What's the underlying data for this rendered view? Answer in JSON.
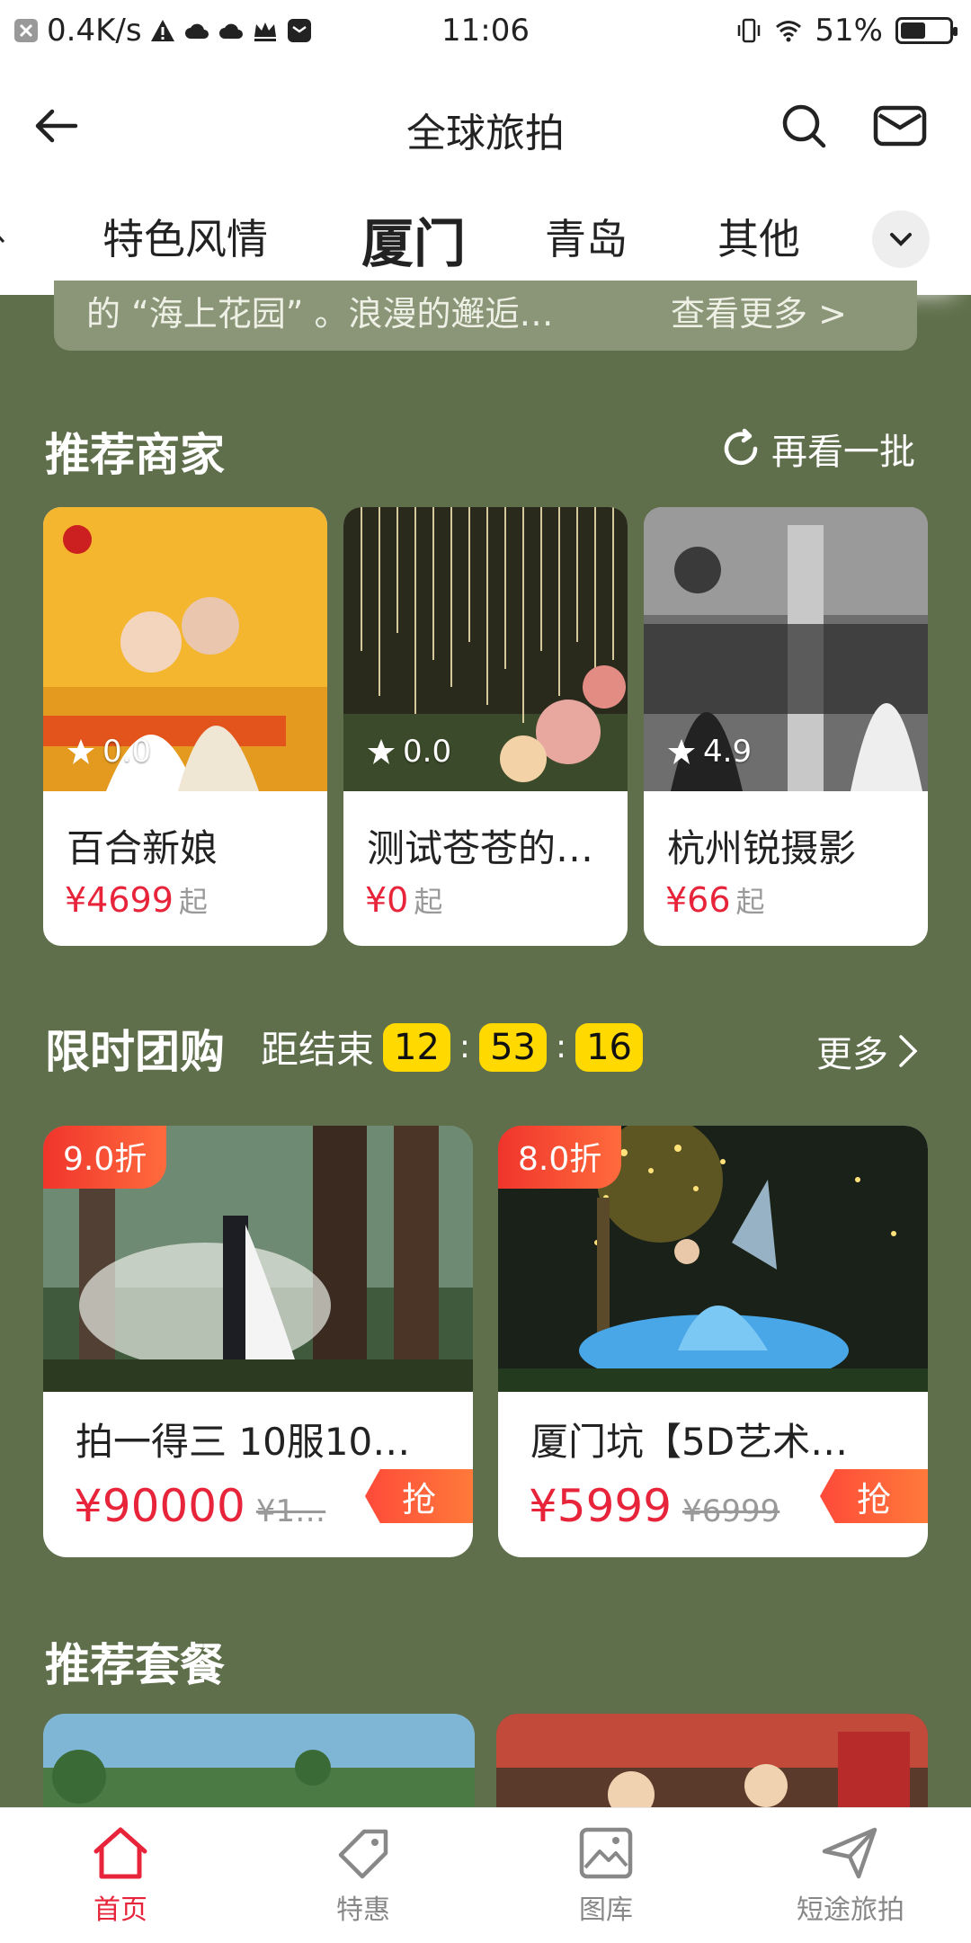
{
  "status_bar": {
    "net_speed": "0.4K/s",
    "time": "11:06",
    "battery": "51%",
    "battery_level": 0.51
  },
  "header": {
    "title": "全球旅拍"
  },
  "tabs": [
    {
      "label": "特色风情",
      "active": false
    },
    {
      "label": "厦门",
      "active": true
    },
    {
      "label": "青岛",
      "active": false
    },
    {
      "label": "其他",
      "active": false
    }
  ],
  "intro": {
    "text": "的 “海上花园” 。浪漫的邂逅…",
    "more": "查看更多 >"
  },
  "merchants": {
    "title": "推荐商家",
    "refresh": "再看一批",
    "items": [
      {
        "name": "百合新娘",
        "rating": "0.0",
        "price": "¥4699",
        "suffix": "起"
      },
      {
        "name": "测试苍苍的…",
        "rating": "0.0",
        "price": "¥0",
        "suffix": "起"
      },
      {
        "name": "杭州锐摄影",
        "rating": "4.9",
        "price": "¥66",
        "suffix": "起"
      }
    ]
  },
  "group_buy": {
    "title": "限时团购",
    "countdown_label": "距结束",
    "hours": "12",
    "minutes": "53",
    "seconds": "16",
    "more": "更多",
    "items": [
      {
        "badge": "9.0折",
        "name": "拍一得三 10服10…",
        "price": "¥90000",
        "orig": "¥1…",
        "grab": "抢"
      },
      {
        "badge": "8.0折",
        "name": "厦门坑【5D艺术…",
        "price": "¥5999",
        "orig": "¥6999",
        "grab": "抢"
      }
    ]
  },
  "packages": {
    "title": "推荐套餐"
  },
  "bottom_nav": [
    {
      "label": "首页",
      "icon": "home-icon",
      "active": true
    },
    {
      "label": "特惠",
      "icon": "tag-icon",
      "active": false
    },
    {
      "label": "图库",
      "icon": "gallery-icon",
      "active": false
    },
    {
      "label": "短途旅拍",
      "icon": "paper-plane-icon",
      "active": false
    }
  ],
  "colors": {
    "accent": "#e8243b",
    "background": "#5f6f4b",
    "timer": "#ffd900"
  }
}
